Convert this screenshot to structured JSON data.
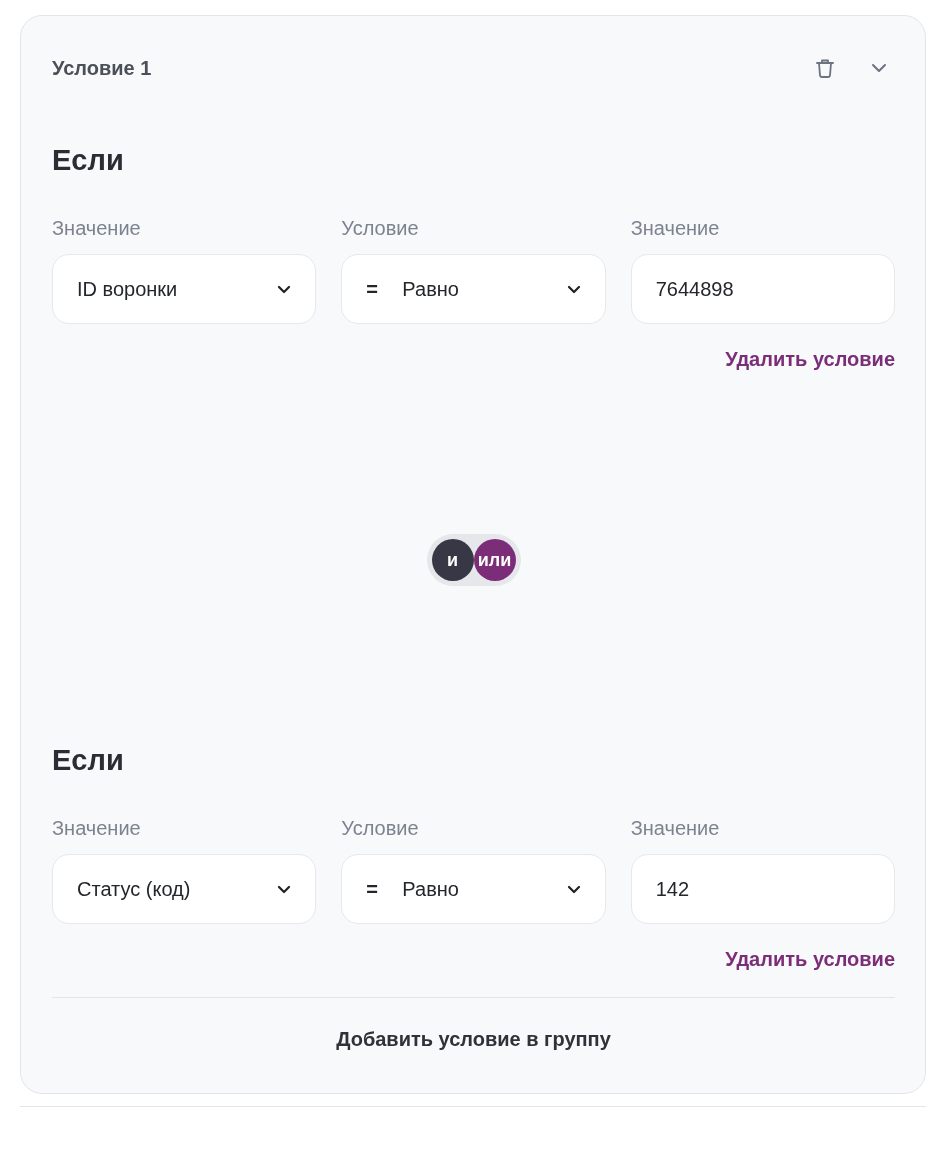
{
  "card": {
    "title": "Условие 1"
  },
  "conditions": [
    {
      "heading": "Если",
      "fields": [
        {
          "kind": "select",
          "label": "Значение",
          "value": "ID воронки"
        },
        {
          "kind": "select",
          "label": "Условие",
          "prefix": "=",
          "value": "Равно"
        },
        {
          "kind": "input",
          "label": "Значение",
          "value": "7644898"
        }
      ],
      "delete_link": "Удалить условие"
    },
    {
      "heading": "Если",
      "fields": [
        {
          "kind": "select",
          "label": "Значение",
          "value": "Статус (код)"
        },
        {
          "kind": "select",
          "label": "Условие",
          "prefix": "=",
          "value": "Равно"
        },
        {
          "kind": "input",
          "label": "Значение",
          "value": "142"
        }
      ],
      "delete_link": "Удалить условие"
    }
  ],
  "logic_toggle": [
    {
      "label": "и",
      "color": "#363845"
    },
    {
      "label": "или",
      "color": "#7b2d77"
    }
  ],
  "add_button": "Добавить условие в группу"
}
